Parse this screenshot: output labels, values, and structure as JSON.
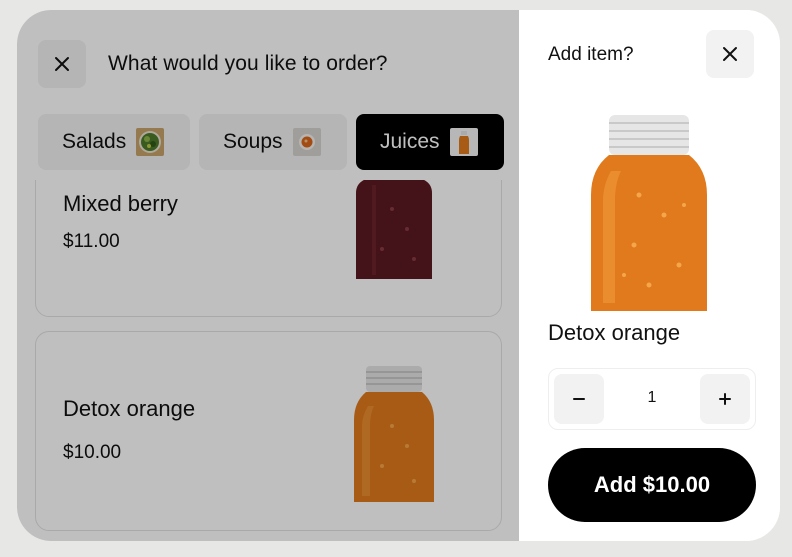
{
  "header": {
    "title": "What would you like to order?"
  },
  "tabs": [
    {
      "label": "Salads",
      "thumb_icon": "salad-bowl-icon"
    },
    {
      "label": "Soups",
      "thumb_icon": "soup-bowl-icon"
    },
    {
      "label": "Juices",
      "thumb_icon": "juice-bottle-icon",
      "active": true
    }
  ],
  "items": [
    {
      "name": "Mixed berry",
      "price": "$11.00",
      "color": "#5a1a22"
    },
    {
      "name": "Detox orange",
      "price": "$10.00",
      "color": "#e07a1c"
    }
  ],
  "panel": {
    "title": "Add item?",
    "item_name": "Detox orange",
    "quantity": "1",
    "minus_label": "−",
    "plus_label": "+",
    "add_label": "Add $10.00"
  },
  "colors": {
    "accent": "#000000",
    "orange_juice": "#e07a1c",
    "berry_juice": "#5a1a22"
  }
}
